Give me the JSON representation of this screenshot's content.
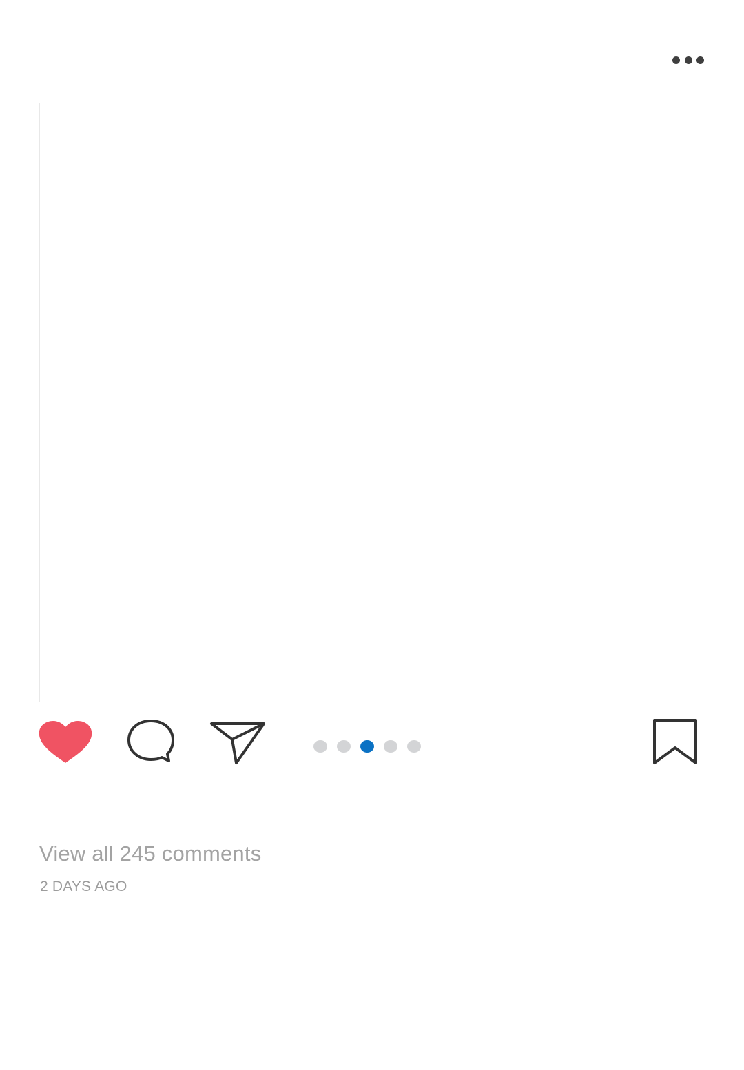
{
  "post": {
    "more_icon": "ellipsis-horizontal-icon",
    "actions": {
      "like_icon": "heart-filled-icon",
      "like_color": "#f05363",
      "comment_icon": "speech-bubble-icon",
      "share_icon": "paper-plane-icon",
      "save_icon": "bookmark-icon",
      "icon_color": "#333333"
    },
    "carousel": {
      "total": 5,
      "current": 3,
      "active_color": "#0b72c4",
      "inactive_color": "#d3d4d6"
    },
    "comments_link": "View all 245 comments",
    "timestamp": "2 DAYS AGO"
  }
}
